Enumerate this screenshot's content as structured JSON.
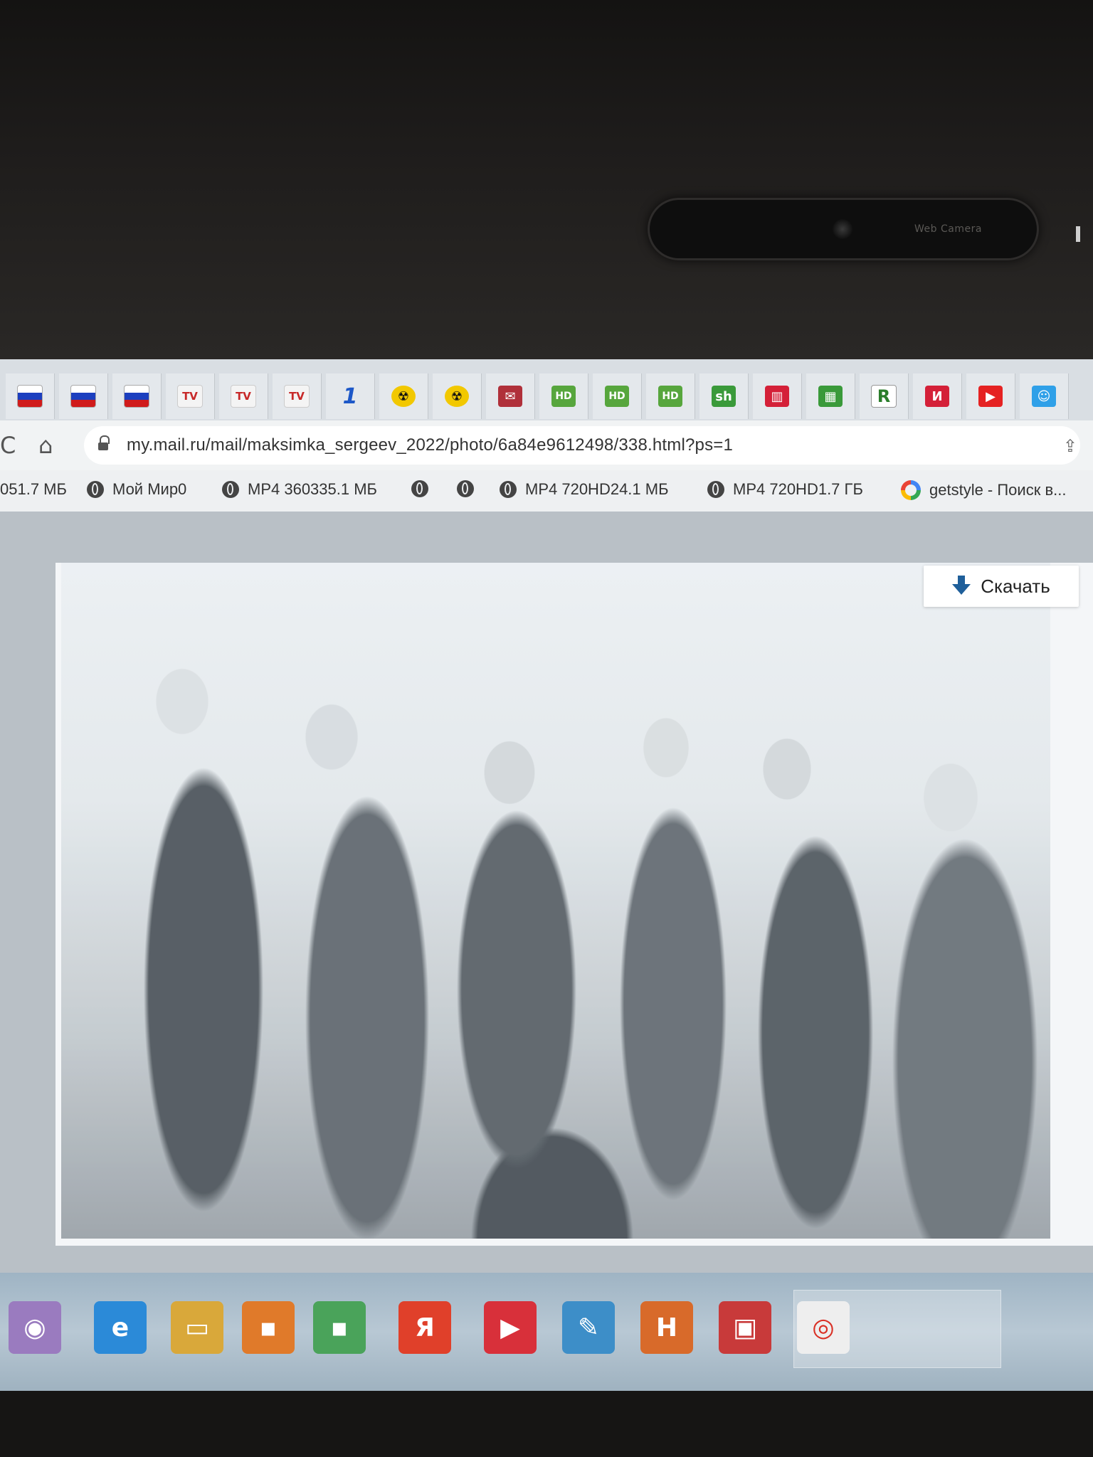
{
  "bezel": {
    "webcam_label": "Web Camera"
  },
  "tabs": [
    {
      "icon": "flag-ru-icon",
      "glyph": ""
    },
    {
      "icon": "flag-ru-icon",
      "glyph": ""
    },
    {
      "icon": "flag-ru-icon",
      "glyph": ""
    },
    {
      "icon": "tv-icon",
      "glyph": "TV"
    },
    {
      "icon": "tv-icon",
      "glyph": "TV"
    },
    {
      "icon": "tv-icon",
      "glyph": "TV"
    },
    {
      "icon": "channel-one-icon",
      "glyph": "1"
    },
    {
      "icon": "radiation-icon",
      "glyph": "☢"
    },
    {
      "icon": "radiation-icon",
      "glyph": "☢"
    },
    {
      "icon": "mail-world-icon",
      "glyph": "✉"
    },
    {
      "icon": "hd-icon",
      "glyph": "HD"
    },
    {
      "icon": "hd-icon",
      "glyph": "HD"
    },
    {
      "icon": "hd-icon",
      "glyph": "HD"
    },
    {
      "icon": "sh-icon",
      "glyph": "sh"
    },
    {
      "icon": "popcorn-icon",
      "glyph": "▥"
    },
    {
      "icon": "green-icon",
      "glyph": "▦"
    },
    {
      "icon": "r-icon",
      "glyph": "R"
    },
    {
      "icon": "red-app-icon",
      "glyph": "И"
    },
    {
      "icon": "youtube-icon",
      "glyph": "▶"
    },
    {
      "icon": "smile-icon",
      "glyph": "☺"
    }
  ],
  "address": {
    "url": "my.mail.ru/mail/maksimka_sergeev_2022/photo/6a84e9612498/338.html?ps=1"
  },
  "bookmarks": [
    {
      "label": "051.7 МБ",
      "icon": "none"
    },
    {
      "label": "Мой Мир0",
      "icon": "globe-icon"
    },
    {
      "label": "MP4 360335.1 МБ",
      "icon": "globe-icon"
    },
    {
      "label": "",
      "icon": "globe-icon"
    },
    {
      "label": "",
      "icon": "globe-icon"
    },
    {
      "label": "MP4 720HD24.1 МБ",
      "icon": "globe-icon"
    },
    {
      "label": "MP4 720HD1.7 ГБ",
      "icon": "globe-icon"
    },
    {
      "label": "getstyle - Поиск в...",
      "icon": "google-icon"
    }
  ],
  "photo_viewer": {
    "download_label": "Скачать"
  },
  "taskbar": [
    {
      "icon": "alice-icon",
      "glyph": "◉"
    },
    {
      "icon": "ie-icon",
      "glyph": "e"
    },
    {
      "icon": "folder-icon",
      "glyph": "▭"
    },
    {
      "icon": "orange-app-icon",
      "glyph": "▪"
    },
    {
      "icon": "green-app-icon",
      "glyph": "▪"
    },
    {
      "icon": "yandex-icon",
      "glyph": "Я"
    },
    {
      "icon": "media-player-icon",
      "glyph": "▶"
    },
    {
      "icon": "paint-icon",
      "glyph": "✎"
    },
    {
      "icon": "html-editor-icon",
      "glyph": "H"
    },
    {
      "icon": "image-viewer-icon",
      "glyph": "▣"
    },
    {
      "icon": "chrome-icon",
      "glyph": "◎"
    }
  ],
  "colors": {
    "screen_bg": "#c9cfd6",
    "taskbar": "#b8c8d4",
    "download_icon": "#1f5f9a"
  }
}
